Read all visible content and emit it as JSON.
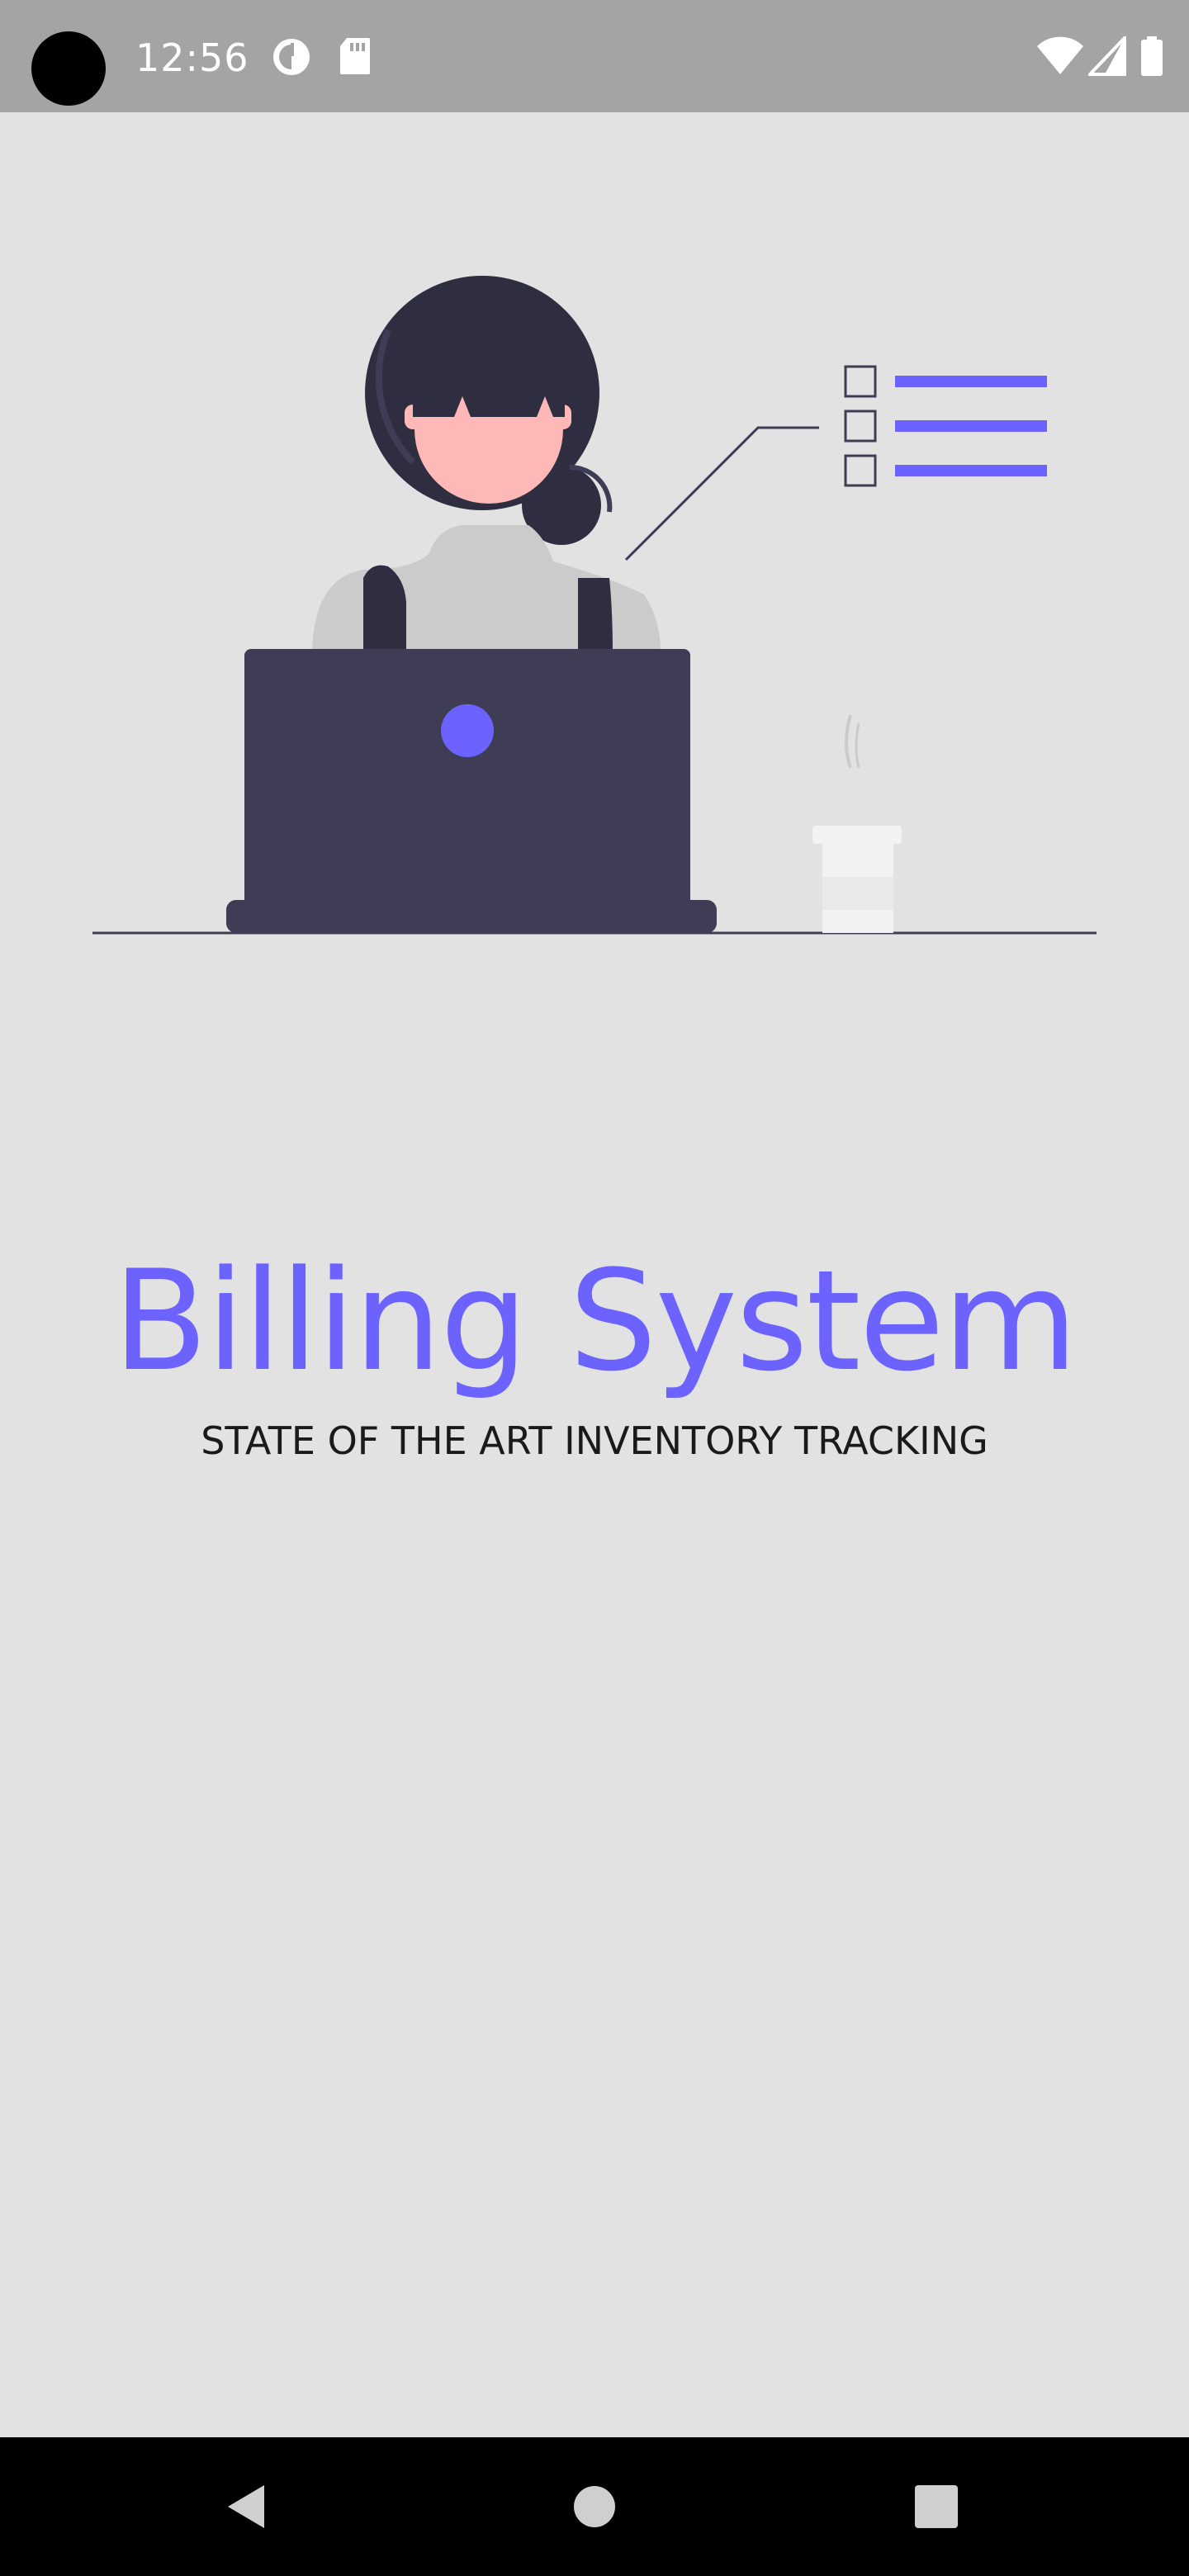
{
  "status_bar": {
    "time": "12:56",
    "icons": [
      "camera-cutout",
      "data-saver-icon",
      "sd-card-icon",
      "wifi-icon",
      "signal-icon",
      "battery-icon"
    ]
  },
  "splash": {
    "title": "Billing System",
    "subtitle": "STATE OF THE ART INVENTORY TRACKING",
    "illustration": "woman-at-laptop-with-checklist-illustration"
  },
  "nav_bar": {
    "buttons": [
      "back-button",
      "home-button",
      "recents-button"
    ]
  },
  "colors": {
    "accent": "#6c63ff",
    "background": "#e2e2e2",
    "status_bar": "#a4a4a4",
    "dark": "#3f3d56",
    "hair": "#2f2e41",
    "skin": "#ffb8b8",
    "shirt": "#cbcbcb"
  }
}
